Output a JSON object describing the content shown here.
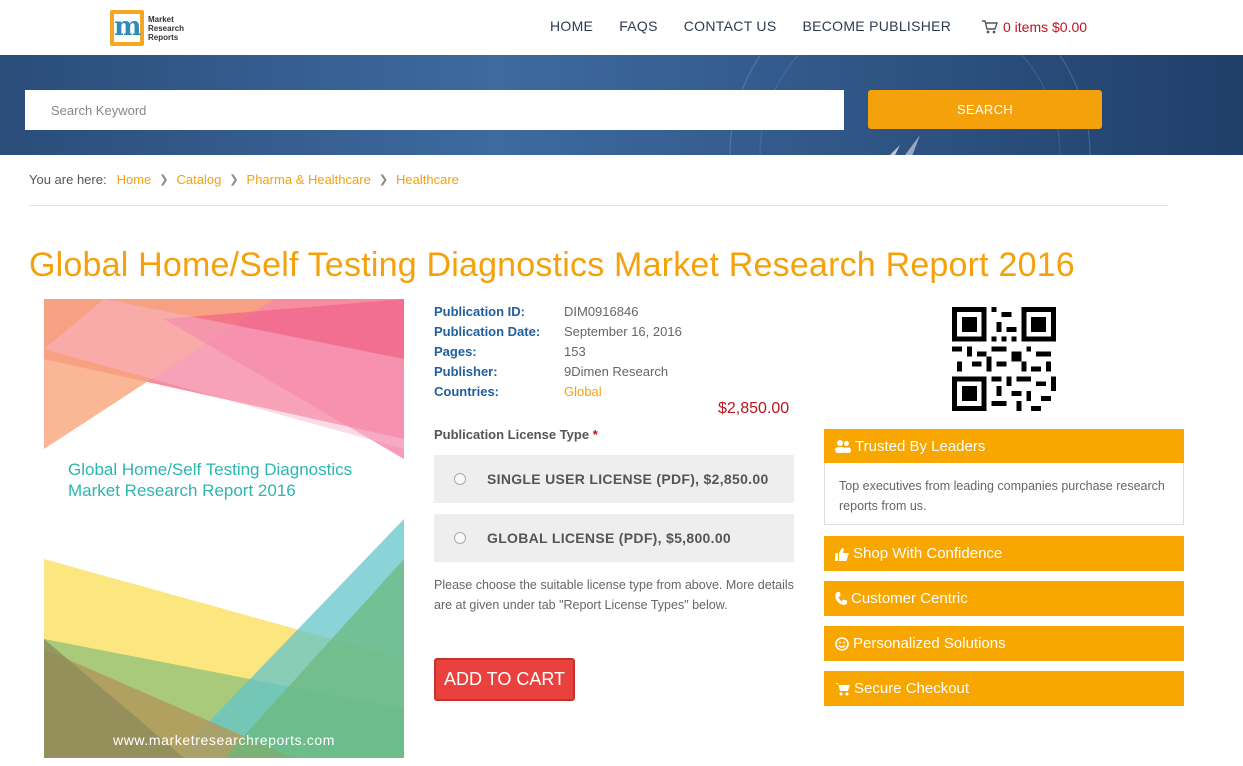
{
  "header": {
    "logo_text": [
      "Market",
      "Research",
      "Reports"
    ],
    "nav": [
      "HOME",
      "FAQS",
      "CONTACT US",
      "BECOME PUBLISHER"
    ],
    "cart": "0 items $0.00"
  },
  "search": {
    "placeholder": "Search Keyword",
    "button": "SEARCH"
  },
  "breadcrumb": {
    "lead": "You are here:",
    "items": [
      "Home",
      "Catalog",
      "Pharma & Healthcare",
      "Healthcare"
    ]
  },
  "title": "Global Home/Self Testing Diagnostics Market Research Report 2016",
  "cover": {
    "title": "Global Home/Self Testing Diagnostics Market Research Report 2016",
    "url": "www.marketresearchreports.com"
  },
  "details": [
    {
      "label": "Publication ID:",
      "value": "DIM0916846"
    },
    {
      "label": "Publication Date:",
      "value": "September 16, 2016"
    },
    {
      "label": "Pages:",
      "value": "153"
    },
    {
      "label": "Publisher:",
      "value": "9Dimen Research"
    },
    {
      "label": "Countries:",
      "value": "Global"
    }
  ],
  "price": "$2,850.00",
  "license": {
    "title": "Publication License Type",
    "required_mark": "*",
    "options": [
      "SINGLE USER LICENSE (PDF), $2,850.00",
      "GLOBAL LICENSE (PDF), $5,800.00"
    ],
    "note": "Please choose the suitable license type from above. More details are at given under tab \"Report License Types\" below."
  },
  "add_to_cart": "ADD TO CART",
  "panels": {
    "trusted": {
      "title": "Trusted By Leaders",
      "body": "Top executives from leading companies purchase research reports from us."
    },
    "shop": "Shop With Confidence",
    "customer": "Customer Centric",
    "personalized": "Personalized Solutions",
    "secure": "Secure Checkout"
  },
  "colors": {
    "accent": "#f5a10c",
    "nav_text": "#2d3b4e",
    "price": "#c0131f",
    "banner": "#2f5585",
    "cart_button": "#e9413e"
  }
}
